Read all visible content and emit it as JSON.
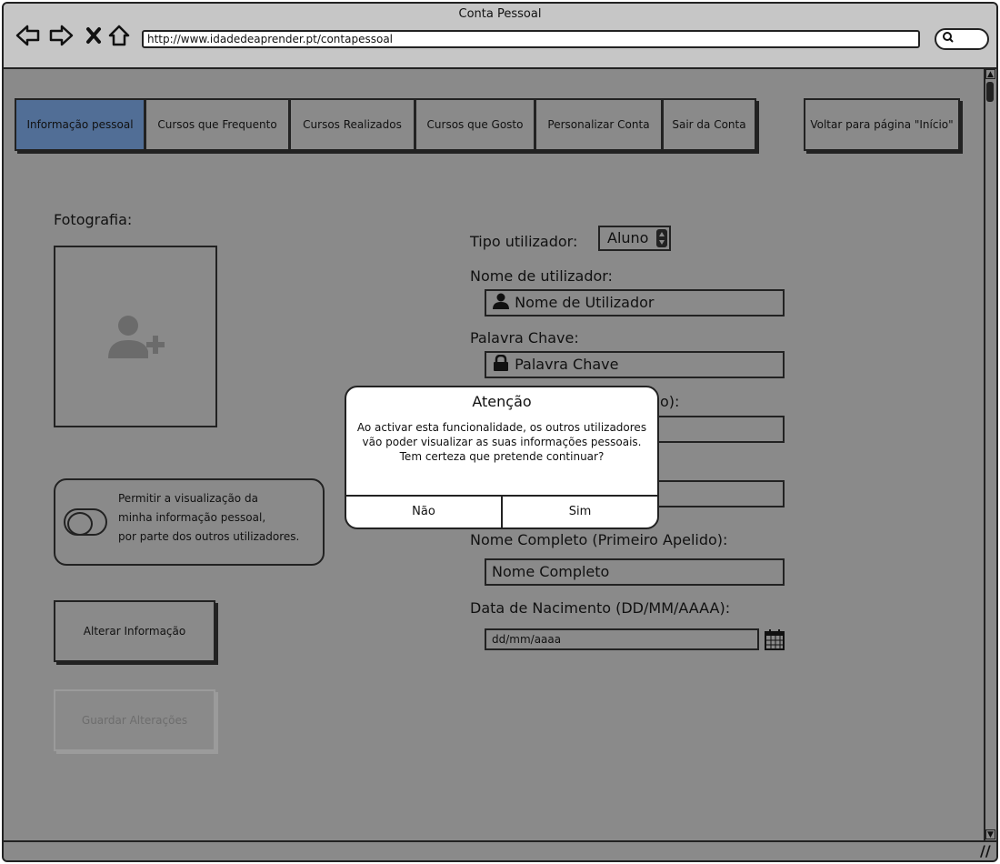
{
  "browser": {
    "title": "Conta Pessoal",
    "url": "http://www.idadedeaprender.pt/contapessoal",
    "icons": [
      "back-arrow-icon",
      "forward-arrow-icon",
      "close-icon",
      "home-icon",
      "search-icon"
    ]
  },
  "tabs": [
    {
      "label": "Informação pessoal",
      "active": true
    },
    {
      "label": "Cursos que Frequento"
    },
    {
      "label": "Cursos Realizados"
    },
    {
      "label": "Cursos que Gosto"
    },
    {
      "label": "Personalizar Conta"
    },
    {
      "label": "Sair da Conta"
    }
  ],
  "back_home_label": "Voltar para página \"Início\"",
  "photo": {
    "label": "Fotografia:",
    "icon": "add-user-icon"
  },
  "privacy": {
    "line1": "Permitir a visualização da",
    "line2": "minha informação pessoal,",
    "line3": "por parte dos outros utilizadores.",
    "enabled": false
  },
  "buttons": {
    "edit": "Alterar Informação",
    "save": "Guardar Alterações"
  },
  "form": {
    "user_type_label": "Tipo  utilizador:",
    "user_type_value": "Aluno",
    "username_label": "Nome de utilizador:",
    "username_placeholder": "Nome de Utilizador",
    "password_label": "Palavra Chave:",
    "password_placeholder": "Palavra Chave",
    "hidden_label_suffix": "o):",
    "fullname_label": "Nome Completo (Primeiro Apelido):",
    "fullname_placeholder": "Nome Completo",
    "birthdate_label": "Data de Nacimento (DD/MM/AAAA):",
    "birthdate_placeholder": "dd/mm/aaaa"
  },
  "dialog": {
    "title": "Atenção",
    "line1": "Ao activar esta funcionalidade, os outros utilizadores",
    "line2": "vão poder visualizar as suas informações pessoais.",
    "line3": "Tem certeza que pretende continuar?",
    "no": "Não",
    "yes": "Sim"
  },
  "colors": {
    "overlay_gray": "#8a8a8a",
    "active_tab": "#516e96",
    "chrome": "#c6c6c6"
  }
}
